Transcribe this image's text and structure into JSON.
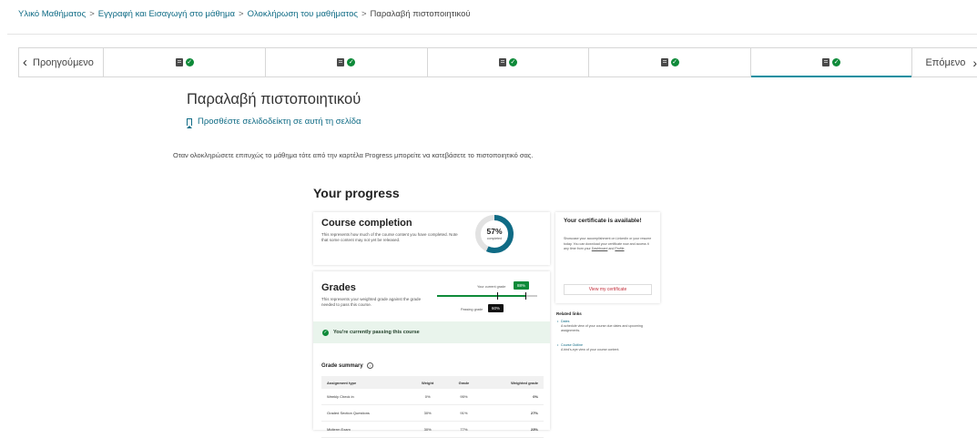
{
  "breadcrumb": {
    "items": [
      "Υλικό Μαθήματος",
      "Εγγραφή και Εισαγωγή στο μάθημα",
      "Ολοκλήρωση του μαθήματος"
    ],
    "current": "Παραλαβή πιστοποιητικού",
    "separator": ">"
  },
  "unit_nav": {
    "prev_label": "Προηγούμενο",
    "next_label": "Επόμενο",
    "active_index": 4,
    "icons": [
      "book-icon",
      "check-circle-icon",
      "chevron-left-icon",
      "chevron-right-icon"
    ]
  },
  "page": {
    "title": "Παραλαβή πιστοποιητικού",
    "bookmark": "Προσθέστε σελιδοδείκτη σε αυτή τη σελίδα",
    "instruction": "Οταν ολοκληρώσετε επιτυχώς το μάθημα τότε από την καρτέλα Progress μπορείτε να κατεβάσετε το πιστοποιητικό σας."
  },
  "progress": {
    "heading": "Your progress",
    "completion": {
      "title": "Course completion",
      "desc": "This represents how much of the course content you have completed. Note that some content may not yet be released.",
      "value": "57%",
      "value_fraction": 0.57,
      "sub": "completed"
    },
    "grades": {
      "title": "Grades",
      "desc": "This represents your weighted grade against the grade needed to pass this course.",
      "current_label": "Your current grade",
      "current_value": "88%",
      "current_fraction": 0.88,
      "passing_label": "Passing grade",
      "passing_value": "60%",
      "passing_fraction": 0.6,
      "passing_msg": "You're currently passing this course"
    },
    "summary": {
      "title": "Grade summary",
      "headers": [
        "Assignment type",
        "Weight",
        "Grade",
        "Weighted grade"
      ],
      "rows": [
        [
          "Weekly Check in",
          "0%",
          "95%",
          "0%"
        ],
        [
          "Graded Section Questions",
          "30%",
          "91%",
          "27%"
        ],
        [
          "Midterm Exam",
          "30%",
          "77%",
          "23%"
        ]
      ]
    },
    "certificate": {
      "title": "Your certificate is available!",
      "desc_before": "Showcase your accomplishment on LinkedIn or your resume today. You can download your certificate now and access it any time from your ",
      "desc_link1": "Dashboard",
      "desc_mid": " and ",
      "desc_link2": "Profile",
      "desc_end": ".",
      "button": "View my certificate"
    },
    "related": {
      "title": "Related links",
      "links": [
        {
          "name": "Dates",
          "desc": "A schedule view of your course due dates and upcoming assignments."
        },
        {
          "name": "Course Outline",
          "desc": "A bird's-eye view of your course content."
        }
      ]
    },
    "colors": {
      "accent": "#0f6b85",
      "success": "#0e8a39",
      "danger": "#c32d3a",
      "donut": "#0f6b85"
    }
  }
}
